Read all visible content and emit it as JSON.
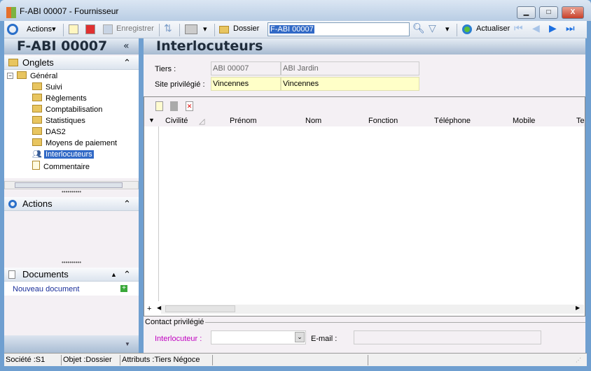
{
  "window": {
    "title": "F-ABI 00007 -  Fournisseur",
    "minimize": "▁",
    "maximize": "□",
    "close": "X"
  },
  "toolbar": {
    "actions": "Actions",
    "save": "Enregistrer",
    "folder": "Dossier",
    "search_value": "F-ABI 00007",
    "refresh": "Actualiser"
  },
  "left": {
    "title": "F-ABI 00007",
    "collapse": "«",
    "onglets": {
      "label": "Onglets",
      "items": [
        "Général",
        "Suivi",
        "Règlements",
        "Comptabilisation",
        "Statistiques",
        "DAS2",
        "Moyens de paiement",
        "Interlocuteurs",
        "Commentaire"
      ],
      "selected": "Interlocuteurs"
    },
    "actions": {
      "label": "Actions"
    },
    "documents": {
      "label": "Documents",
      "new_doc": "Nouveau document"
    }
  },
  "main": {
    "title": "Interlocuteurs",
    "tiers_label": "Tiers :",
    "tiers_code": "ABI 00007",
    "tiers_name": "ABI Jardin",
    "site_label": "Site privilégié :",
    "site_code": "Vincennes",
    "site_name": "Vincennes",
    "columns": [
      "Civilité",
      "Prénom",
      "Nom",
      "Fonction",
      "Téléphone",
      "Mobile",
      "Te"
    ],
    "contact_group": "Contact privilégié",
    "interlocuteur_label": "Interlocuteur :",
    "interlocuteur_value": "",
    "email_label": "E-mail :",
    "email_value": ""
  },
  "status": {
    "societe": "Société :S1",
    "objet": "Objet :Dossier",
    "attributs": "Attributs :Tiers Négoce"
  },
  "colors": {
    "accent": "#3169c6",
    "frame": "#6f9fd0",
    "interlocuteur_label": "#c000c0"
  }
}
